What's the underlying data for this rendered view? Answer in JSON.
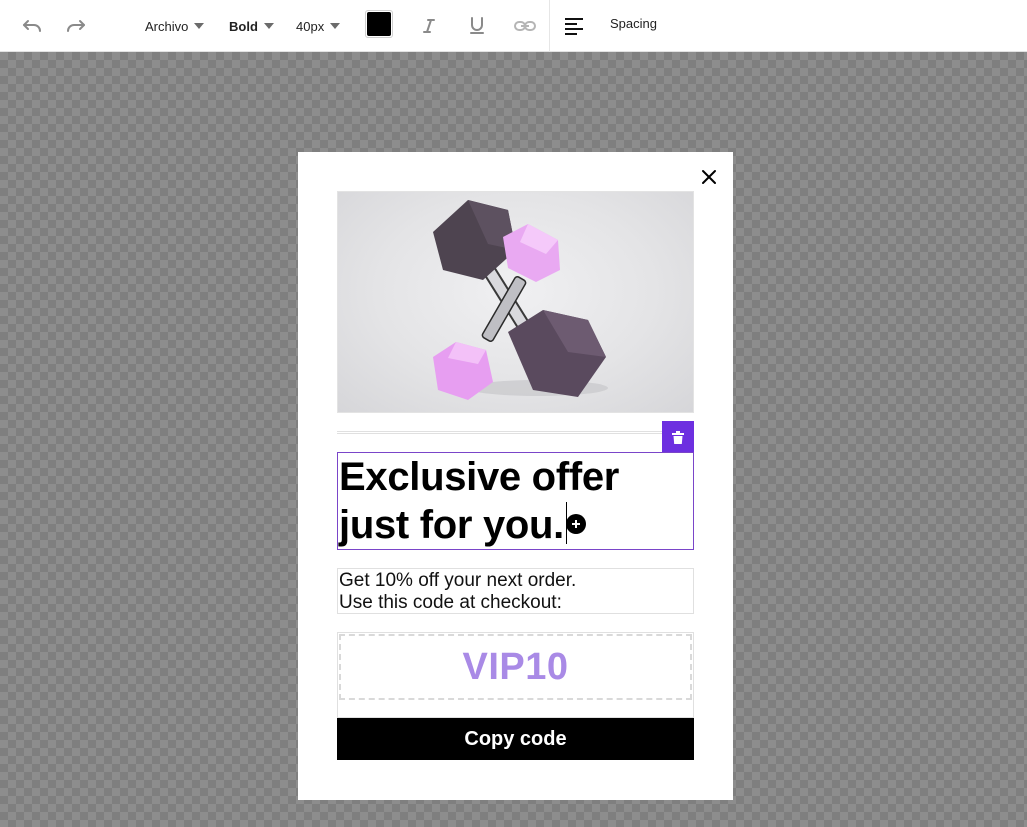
{
  "toolbar": {
    "font_family": "Archivo",
    "font_weight": "Bold",
    "font_size": "40px",
    "text_color": "#000000",
    "spacing_label": "Spacing",
    "icons": [
      "undo-icon",
      "redo-icon",
      "italic-icon",
      "underline-icon",
      "link-icon",
      "align-left-icon"
    ]
  },
  "popup": {
    "close_icon": "close-icon",
    "hero_image": "dumbbells-image",
    "delete_icon": "trash-icon",
    "headline_line1": "Exclusive offer",
    "headline_line2": "just for you.",
    "add_icon": "plus-circle-icon",
    "body_line1": "Get 10% off your next order.",
    "body_line2": "Use this code at checkout:",
    "coupon_code": "VIP10",
    "copy_button_label": "Copy code"
  },
  "colors": {
    "accent": "#6d2fe0",
    "selection_border": "#7a45c9",
    "coupon_text": "#a98ae6",
    "button_bg": "#000000"
  }
}
